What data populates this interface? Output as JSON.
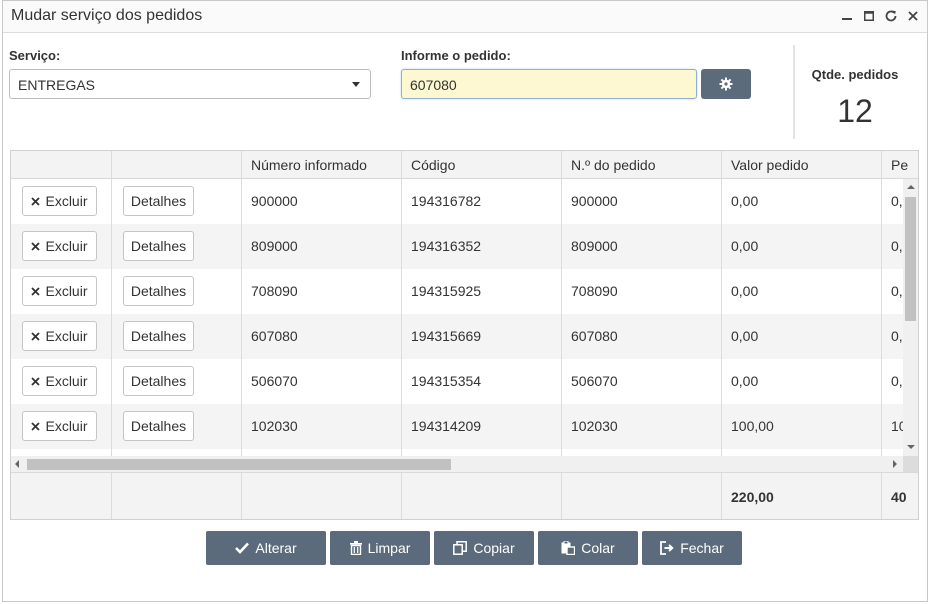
{
  "window": {
    "title": "Mudar serviço dos pedidos"
  },
  "form": {
    "servico_label": "Serviço:",
    "servico_value": "ENTREGAS",
    "pedido_label": "Informe o pedido:",
    "pedido_value": "607080",
    "qtde_label": "Qtde. pedidos",
    "qtde_value": "12"
  },
  "table": {
    "columns": [
      "",
      "",
      "Número informado",
      "Código",
      "N.º do pedido",
      "Valor pedido",
      "Pe"
    ],
    "excluir_label": "Excluir",
    "detalhes_label": "Detalhes",
    "rows": [
      {
        "numero": "900000",
        "codigo": "194316782",
        "pedido": "900000",
        "valor": "0,00",
        "pe": "0,"
      },
      {
        "numero": "809000",
        "codigo": "194316352",
        "pedido": "809000",
        "valor": "0,00",
        "pe": "0,"
      },
      {
        "numero": "708090",
        "codigo": "194315925",
        "pedido": "708090",
        "valor": "0,00",
        "pe": "0,"
      },
      {
        "numero": "607080",
        "codigo": "194315669",
        "pedido": "607080",
        "valor": "0,00",
        "pe": "0,"
      },
      {
        "numero": "506070",
        "codigo": "194315354",
        "pedido": "506070",
        "valor": "0,00",
        "pe": "0,"
      },
      {
        "numero": "102030",
        "codigo": "194314209",
        "pedido": "102030",
        "valor": "100,00",
        "pe": "10"
      }
    ],
    "footer": {
      "valor_total": "220,00",
      "pe_total": "40"
    }
  },
  "actions": {
    "alterar": "Alterar",
    "limpar": "Limpar",
    "copiar": "Copiar",
    "colar": "Colar",
    "fechar": "Fechar"
  },
  "icons": {
    "gear": "gear-icon",
    "minimize": "minimize-icon",
    "maximize": "maximize-icon",
    "refresh": "refresh-icon",
    "close": "close-icon"
  }
}
